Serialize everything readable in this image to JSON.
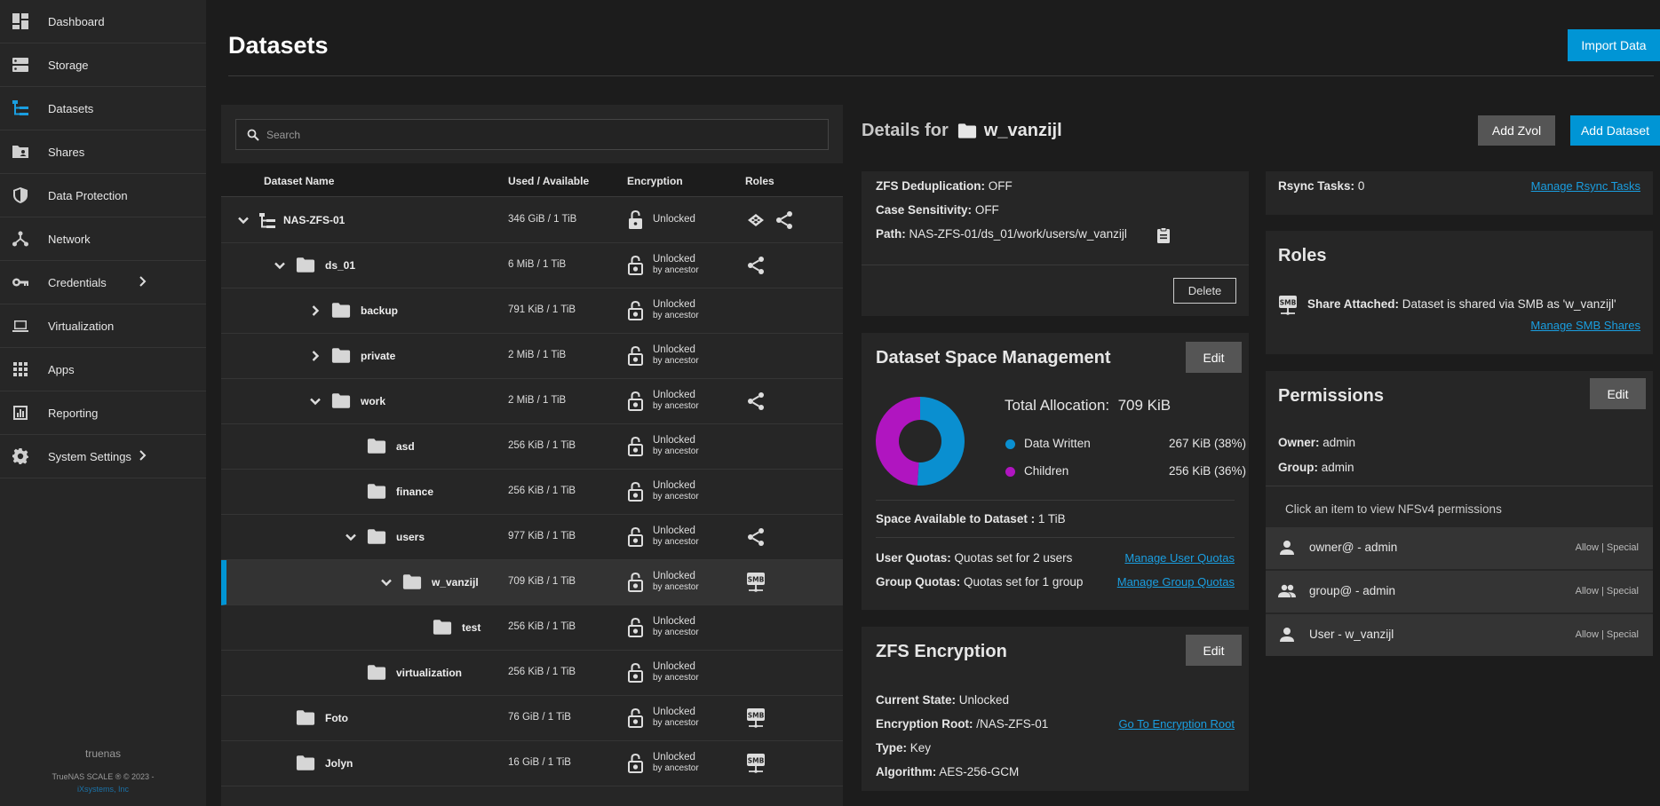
{
  "sidebar": {
    "items": [
      {
        "label": "Dashboard",
        "icon": "dashboard-icon"
      },
      {
        "label": "Storage",
        "icon": "storage-icon"
      },
      {
        "label": "Datasets",
        "icon": "datasets-icon"
      },
      {
        "label": "Shares",
        "icon": "shares-icon"
      },
      {
        "label": "Data Protection",
        "icon": "shield-icon"
      },
      {
        "label": "Network",
        "icon": "network-icon"
      },
      {
        "label": "Credentials",
        "icon": "key-icon"
      },
      {
        "label": "Virtualization",
        "icon": "laptop-icon"
      },
      {
        "label": "Apps",
        "icon": "apps-grid-icon"
      },
      {
        "label": "Reporting",
        "icon": "chart-icon"
      },
      {
        "label": "System Settings",
        "icon": "gear-icon"
      }
    ],
    "active": "Datasets",
    "hostname": "truenas",
    "copyright": "TrueNAS SCALE ® © 2023 -",
    "company": "iXsystems, Inc"
  },
  "header": {
    "title": "Datasets",
    "import_label": "Import Data"
  },
  "tree": {
    "search_placeholder": "Search",
    "columns": {
      "name": "Dataset Name",
      "used": "Used / Available",
      "encryption": "Encryption",
      "roles": "Roles"
    },
    "rows": [
      {
        "name": "NAS-ZFS-01",
        "used": "346 GiB / 1 TiB",
        "enc": "Unlocked",
        "enc_sub": ""
      },
      {
        "name": "ds_01",
        "used": "6 MiB / 1 TiB",
        "enc": "Unlocked",
        "enc_sub": "by ancestor"
      },
      {
        "name": "backup",
        "used": "791 KiB / 1 TiB",
        "enc": "Unlocked",
        "enc_sub": "by ancestor"
      },
      {
        "name": "private",
        "used": "2 MiB / 1 TiB",
        "enc": "Unlocked",
        "enc_sub": "by ancestor"
      },
      {
        "name": "work",
        "used": "2 MiB / 1 TiB",
        "enc": "Unlocked",
        "enc_sub": "by ancestor"
      },
      {
        "name": "asd",
        "used": "256 KiB / 1 TiB",
        "enc": "Unlocked",
        "enc_sub": "by ancestor"
      },
      {
        "name": "finance",
        "used": "256 KiB / 1 TiB",
        "enc": "Unlocked",
        "enc_sub": "by ancestor"
      },
      {
        "name": "users",
        "used": "977 KiB / 1 TiB",
        "enc": "Unlocked",
        "enc_sub": "by ancestor"
      },
      {
        "name": "w_vanzijl",
        "used": "709 KiB / 1 TiB",
        "enc": "Unlocked",
        "enc_sub": "by ancestor"
      },
      {
        "name": "test",
        "used": "256 KiB / 1 TiB",
        "enc": "Unlocked",
        "enc_sub": "by ancestor"
      },
      {
        "name": "virtualization",
        "used": "256 KiB / 1 TiB",
        "enc": "Unlocked",
        "enc_sub": "by ancestor"
      },
      {
        "name": "Foto",
        "used": "76 GiB / 1 TiB",
        "enc": "Unlocked",
        "enc_sub": "by ancestor"
      },
      {
        "name": "Jolyn",
        "used": "16 GiB / 1 TiB",
        "enc": "Unlocked",
        "enc_sub": "by ancestor"
      }
    ]
  },
  "details": {
    "prefix": "Details for",
    "dataset": "w_vanzijl",
    "add_zvol": "Add Zvol",
    "add_dataset": "Add Dataset",
    "summary": {
      "dedup_label": "ZFS Deduplication:",
      "dedup": "OFF",
      "case_label": "Case Sensitivity:",
      "case": "OFF",
      "path_label": "Path:",
      "path": "NAS-ZFS-01/ds_01/work/users/w_vanzijl",
      "delete": "Delete"
    },
    "space": {
      "title": "Dataset Space Management",
      "edit": "Edit",
      "total_label": "Total Allocation:",
      "total": "709 KiB",
      "legend": [
        {
          "name": "Data Written",
          "value": "267 KiB (38%)",
          "color": "#0a8fd0",
          "fraction": 0.51
        },
        {
          "name": "Children",
          "value": "256 KiB (36%)",
          "color": "#b015c0",
          "fraction": 0.49
        }
      ],
      "available_label": "Space Available to Dataset :",
      "available": "1 TiB",
      "user_quotas_label": "User Quotas:",
      "user_quotas": "Quotas set for 2 users",
      "manage_user": "Manage User Quotas",
      "group_quotas_label": "Group Quotas:",
      "group_quotas": "Quotas set for 1 group",
      "manage_group": "Manage Group Quotas"
    },
    "encryption": {
      "title": "ZFS Encryption",
      "edit": "Edit",
      "state_label": "Current State:",
      "state": "Unlocked",
      "root_label": "Encryption Root:",
      "root": "/NAS-ZFS-01",
      "go_root": "Go To Encryption Root",
      "type_label": "Type:",
      "type": "Key",
      "algo_label": "Algorithm:",
      "algo": "AES-256-GCM"
    },
    "rsync": {
      "label": "Rsync Tasks:",
      "value": "0",
      "manage": "Manage Rsync Tasks"
    },
    "roles": {
      "title": "Roles",
      "smb_badge": "SMB",
      "share_label": "Share Attached:",
      "share": "Dataset is shared via SMB as 'w_vanzijl'",
      "manage": "Manage SMB Shares"
    },
    "permissions": {
      "title": "Permissions",
      "edit": "Edit",
      "owner_label": "Owner:",
      "owner": "admin",
      "group_label": "Group:",
      "group": "admin",
      "hint": "Click an item to view NFSv4 permissions",
      "entries": [
        {
          "label": "owner@ - admin",
          "tag": "Allow | Special",
          "icon": "person-icon"
        },
        {
          "label": "group@ - admin",
          "tag": "Allow | Special",
          "icon": "group-icon"
        },
        {
          "label": "User - w_vanzijl",
          "tag": "Allow | Special",
          "icon": "person-icon"
        }
      ]
    }
  }
}
